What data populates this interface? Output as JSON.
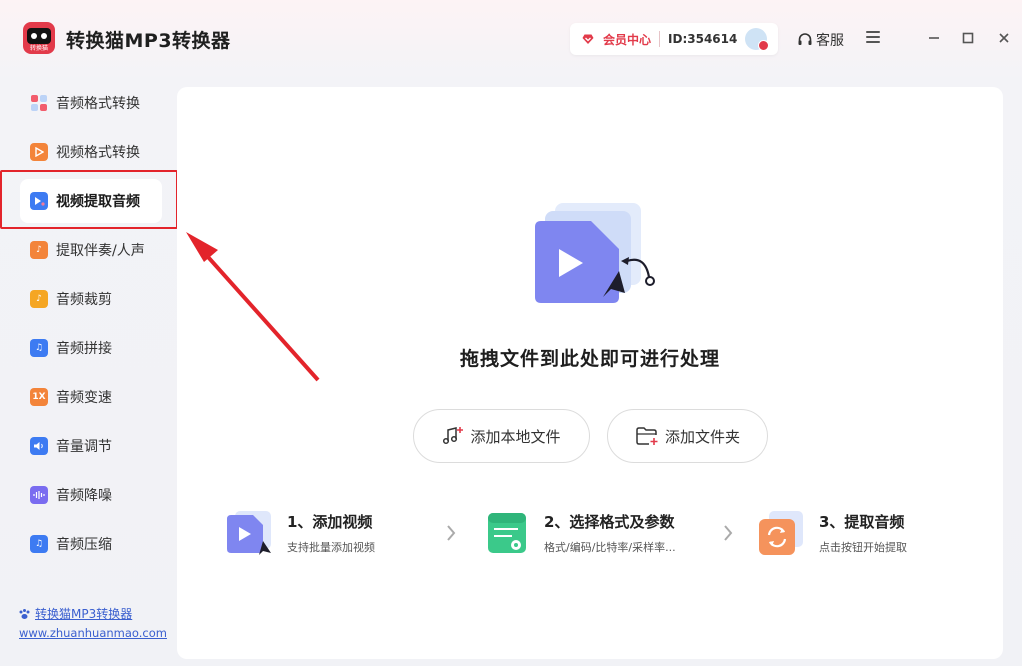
{
  "app": {
    "title": "转换猫MP3转换器",
    "logo_text": "转换猫"
  },
  "header": {
    "vip_label": "会员中心",
    "user_id": "ID:354614",
    "service_label": "客服",
    "accent": "#e23a4a"
  },
  "sidebar": {
    "items": [
      {
        "label": "音频格式转换",
        "icon": "audio-format-icon",
        "color": "#f25c6c"
      },
      {
        "label": "视频格式转换",
        "icon": "video-format-icon",
        "color": "#f3843a"
      },
      {
        "label": "视频提取音频",
        "icon": "video-extract-audio-icon",
        "color": "#3d7bf2",
        "active": true
      },
      {
        "label": "提取伴奏/人声",
        "icon": "extract-vocal-icon",
        "color": "#f3843a"
      },
      {
        "label": "音频裁剪",
        "icon": "audio-cut-icon",
        "color": "#f5a623"
      },
      {
        "label": "音频拼接",
        "icon": "audio-join-icon",
        "color": "#3d7bf2"
      },
      {
        "label": "音频变速",
        "icon": "audio-speed-icon",
        "color": "#f3843a",
        "glyph": "1X"
      },
      {
        "label": "音量调节",
        "icon": "volume-icon",
        "color": "#3d7bf2"
      },
      {
        "label": "音频降噪",
        "icon": "denoise-icon",
        "color": "#7a6cf0"
      },
      {
        "label": "音频压缩",
        "icon": "audio-compress-icon",
        "color": "#3d7bf2"
      }
    ],
    "footer_link": "转换猫MP3转换器",
    "footer_url": "www.zhuanhuanmao.com"
  },
  "main": {
    "drop_title": "拖拽文件到此处即可进行处理",
    "add_file_label": "添加本地文件",
    "add_folder_label": "添加文件夹",
    "steps": [
      {
        "title": "1、添加视频",
        "desc": "支持批量添加视频"
      },
      {
        "title": "2、选择格式及参数",
        "desc": "格式/编码/比特率/采样率..."
      },
      {
        "title": "3、提取音频",
        "desc": "点击按钮开始提取"
      }
    ]
  }
}
